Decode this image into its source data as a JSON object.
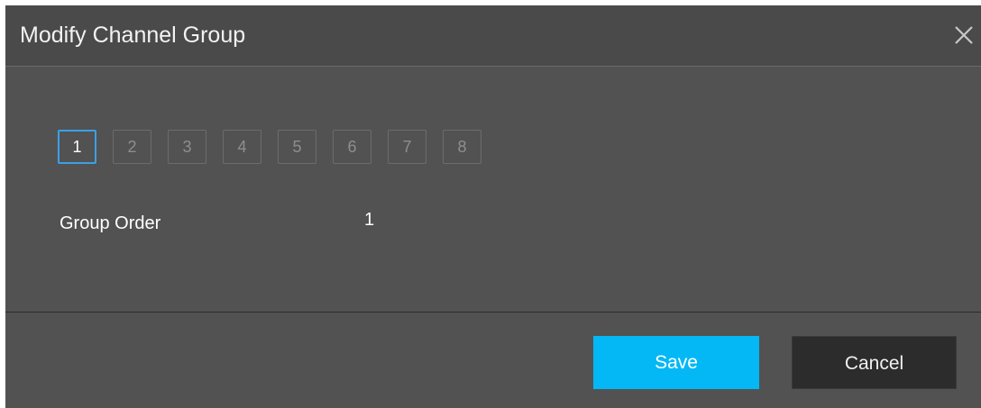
{
  "dialog": {
    "title": "Modify Channel Group",
    "close_icon": "close-icon"
  },
  "channels": {
    "items": [
      "1",
      "2",
      "3",
      "4",
      "5",
      "6",
      "7",
      "8"
    ],
    "selected": "1"
  },
  "group_order": {
    "label": "Group Order",
    "value": "1"
  },
  "buttons": {
    "save_label": "Save",
    "cancel_label": "Cancel"
  },
  "colors": {
    "accent": "#04b8f5",
    "selected_border": "#3aa0e6",
    "background": "#525252"
  }
}
